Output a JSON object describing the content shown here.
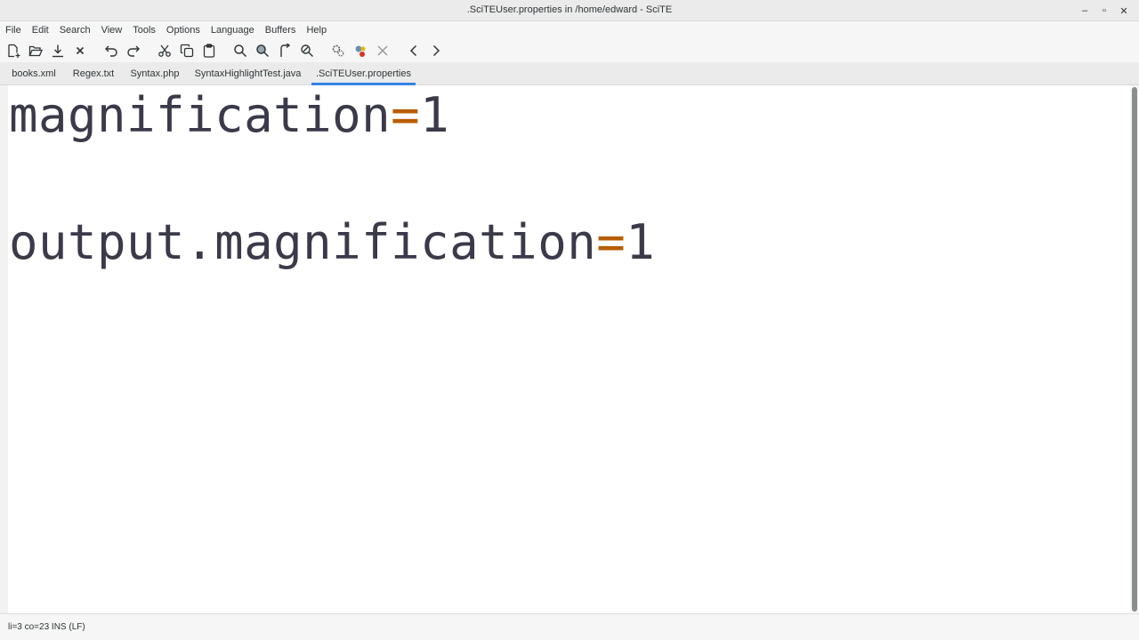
{
  "window": {
    "title": ".SciTEUser.properties in /home/edward - SciTE",
    "minimize": "–",
    "maximize": "▫",
    "close": "✕"
  },
  "menu": {
    "items": [
      "File",
      "Edit",
      "Search",
      "View",
      "Tools",
      "Options",
      "Language",
      "Buffers",
      "Help"
    ]
  },
  "toolbar": {
    "icons": [
      "new-file-icon",
      "open-file-icon",
      "save-icon",
      "close-file-icon",
      "undo-icon",
      "redo-icon",
      "cut-icon",
      "copy-icon",
      "paste-icon",
      "find-icon",
      "find-in-files-icon",
      "go-to-icon",
      "replace-icon",
      "compile-icon",
      "build-icon",
      "stop-icon",
      "previous-icon",
      "next-icon"
    ]
  },
  "tabs": {
    "items": [
      {
        "label": "books.xml",
        "active": false
      },
      {
        "label": "Regex.txt",
        "active": false
      },
      {
        "label": "Syntax.php",
        "active": false
      },
      {
        "label": "SyntaxHighlightTest.java",
        "active": false
      },
      {
        "label": ".SciTEUser.properties",
        "active": true
      }
    ],
    "active_color": "#3584e4"
  },
  "editor": {
    "lines": [
      {
        "key": "magnification",
        "op": "=",
        "value": "1"
      },
      {
        "key": "",
        "op": "",
        "value": ""
      },
      {
        "key": "output.magnification",
        "op": "=",
        "value": "1"
      }
    ],
    "colors": {
      "text": "#3a3a4a",
      "operator": "#b85c00"
    }
  },
  "status": {
    "text": "li=3 co=23 INS (LF)"
  }
}
